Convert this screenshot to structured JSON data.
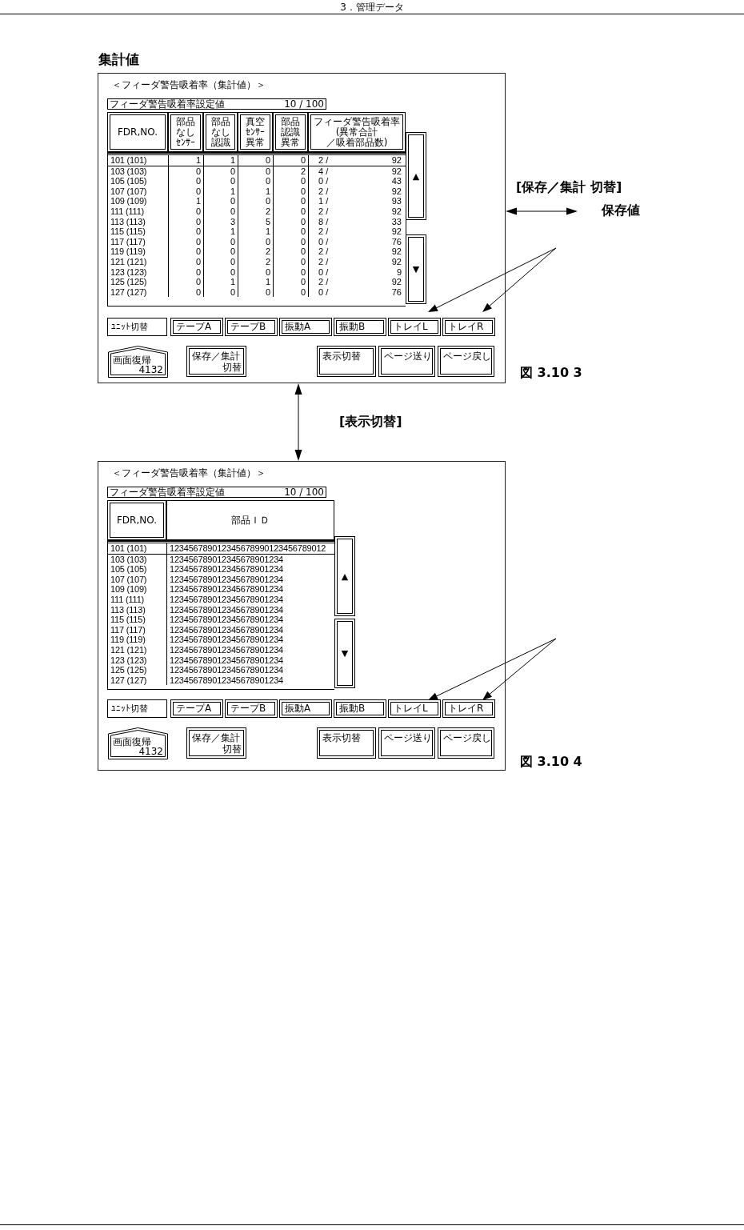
{
  "header": {
    "title": "3．管理データ"
  },
  "section_title": "集計値",
  "annotations": {
    "toggle_label": "[保存／集計 切替]",
    "target_label": "保存値",
    "switch_label": "[表示切替]"
  },
  "figures": [
    {
      "caption": "図 3.10 3",
      "screen": {
        "kind": "summary",
        "title": "＜フィーダ警告吸着率（集計値）＞",
        "setting": {
          "label": "フィーダ警告吸着率設定値",
          "value": "10 / 100"
        },
        "columns": [
          {
            "lines": [
              "FDR,NO."
            ],
            "raised": true
          },
          {
            "lines": [
              "部品",
              "なし",
              "ｾﾝｻｰ"
            ],
            "raised": true
          },
          {
            "lines": [
              "部品",
              "なし",
              "認識"
            ],
            "raised": true
          },
          {
            "lines": [
              "真空",
              "ｾﾝｻｰ",
              "異常"
            ],
            "raised": true
          },
          {
            "lines": [
              "部品",
              "認識",
              "異常"
            ],
            "raised": true
          },
          {
            "lines": [
              "フィーダ警告吸着率",
              "(異常合計",
              "／吸着部品数)"
            ],
            "raised": true
          }
        ],
        "rows": [
          {
            "fdr": "101 (101)",
            "counts": [
              "1",
              "1",
              "0",
              "0"
            ],
            "ratio": "2 /",
            "total": "92"
          },
          {
            "fdr": "103 (103)",
            "counts": [
              "0",
              "0",
              "0",
              "2"
            ],
            "ratio": "4 /",
            "total": "92"
          },
          {
            "fdr": "105 (105)",
            "counts": [
              "0",
              "0",
              "0",
              "0"
            ],
            "ratio": "0 /",
            "total": "43"
          },
          {
            "fdr": "107 (107)",
            "counts": [
              "0",
              "1",
              "1",
              "0"
            ],
            "ratio": "2 /",
            "total": "92"
          },
          {
            "fdr": "109 (109)",
            "counts": [
              "1",
              "0",
              "0",
              "0"
            ],
            "ratio": "1 /",
            "total": "93"
          },
          {
            "fdr": "111 (111)",
            "counts": [
              "0",
              "0",
              "2",
              "0"
            ],
            "ratio": "2 /",
            "total": "92"
          },
          {
            "fdr": "113 (113)",
            "counts": [
              "0",
              "3",
              "5",
              "0"
            ],
            "ratio": "8 /",
            "total": "33"
          },
          {
            "fdr": "115 (115)",
            "counts": [
              "0",
              "1",
              "1",
              "0"
            ],
            "ratio": "2 /",
            "total": "92"
          },
          {
            "fdr": "117 (117)",
            "counts": [
              "0",
              "0",
              "0",
              "0"
            ],
            "ratio": "0 /",
            "total": "76"
          },
          {
            "fdr": "119 (119)",
            "counts": [
              "0",
              "0",
              "2",
              "0"
            ],
            "ratio": "2 /",
            "total": "92"
          },
          {
            "fdr": "121 (121)",
            "counts": [
              "0",
              "0",
              "2",
              "0"
            ],
            "ratio": "2 /",
            "total": "92"
          },
          {
            "fdr": "123 (123)",
            "counts": [
              "0",
              "0",
              "0",
              "0"
            ],
            "ratio": "0 /",
            "total": "9"
          },
          {
            "fdr": "125 (125)",
            "counts": [
              "0",
              "1",
              "1",
              "0"
            ],
            "ratio": "2 /",
            "total": "92"
          },
          {
            "fdr": "127 (127)",
            "counts": [
              "0",
              "0",
              "0",
              "0"
            ],
            "ratio": "0 /",
            "total": "76"
          }
        ],
        "scroll_buttons": [
          "▲",
          "▼"
        ],
        "unit_label": "ﾕﾆｯﾄ切替",
        "unit_tabs": [
          "テープA",
          "テープB",
          "振動A",
          "振動B",
          "トレイL",
          "トレイR"
        ],
        "left_buttons": [
          {
            "kind": "home",
            "label": "画面復帰",
            "code": "4132"
          },
          {
            "kind": "plain",
            "label": "保存／集計",
            "code": "切替"
          }
        ],
        "right_buttons": [
          "表示切替",
          "ページ送り",
          "ページ戻し"
        ]
      }
    },
    {
      "caption": "図 3.10 4",
      "screen": {
        "kind": "ids",
        "title": "＜フィーダ警告吸着率（集計値）＞",
        "setting": {
          "label": "フィーダ警告吸着率設定値",
          "value": "10 / 100"
        },
        "columns": [
          {
            "lines": [
              "FDR,NO."
            ],
            "raised": true
          },
          {
            "lines": [
              "部品ＩＤ"
            ],
            "raised": false
          }
        ],
        "rows": [
          {
            "fdr": "101 (101)",
            "part_id": "123456789012345678990123456789012"
          },
          {
            "fdr": "103 (103)",
            "part_id": "123456789012345678901234"
          },
          {
            "fdr": "105 (105)",
            "part_id": "123456789012345678901234"
          },
          {
            "fdr": "107 (107)",
            "part_id": "123456789012345678901234"
          },
          {
            "fdr": "109 (109)",
            "part_id": "123456789012345678901234"
          },
          {
            "fdr": "111 (111)",
            "part_id": "123456789012345678901234"
          },
          {
            "fdr": "113 (113)",
            "part_id": "123456789012345678901234"
          },
          {
            "fdr": "115 (115)",
            "part_id": "123456789012345678901234"
          },
          {
            "fdr": "117 (117)",
            "part_id": "123456789012345678901234"
          },
          {
            "fdr": "119 (119)",
            "part_id": "123456789012345678901234"
          },
          {
            "fdr": "121 (121)",
            "part_id": "123456789012345678901234"
          },
          {
            "fdr": "123 (123)",
            "part_id": "123456789012345678901234"
          },
          {
            "fdr": "125 (125)",
            "part_id": "123456789012345678901234"
          },
          {
            "fdr": "127 (127)",
            "part_id": "123456789012345678901234"
          }
        ],
        "scroll_buttons": [
          "▲",
          "▼"
        ],
        "unit_label": "ﾕﾆｯﾄ切替",
        "unit_tabs": [
          "テープA",
          "テープB",
          "振動A",
          "振動B",
          "トレイL",
          "トレイR"
        ],
        "left_buttons": [
          {
            "kind": "home",
            "label": "画面復帰",
            "code": "4132"
          },
          {
            "kind": "plain",
            "label": "保存／集計",
            "code": "切替"
          }
        ],
        "right_buttons": [
          "表示切替",
          "ページ送り",
          "ページ戻し"
        ]
      }
    }
  ]
}
